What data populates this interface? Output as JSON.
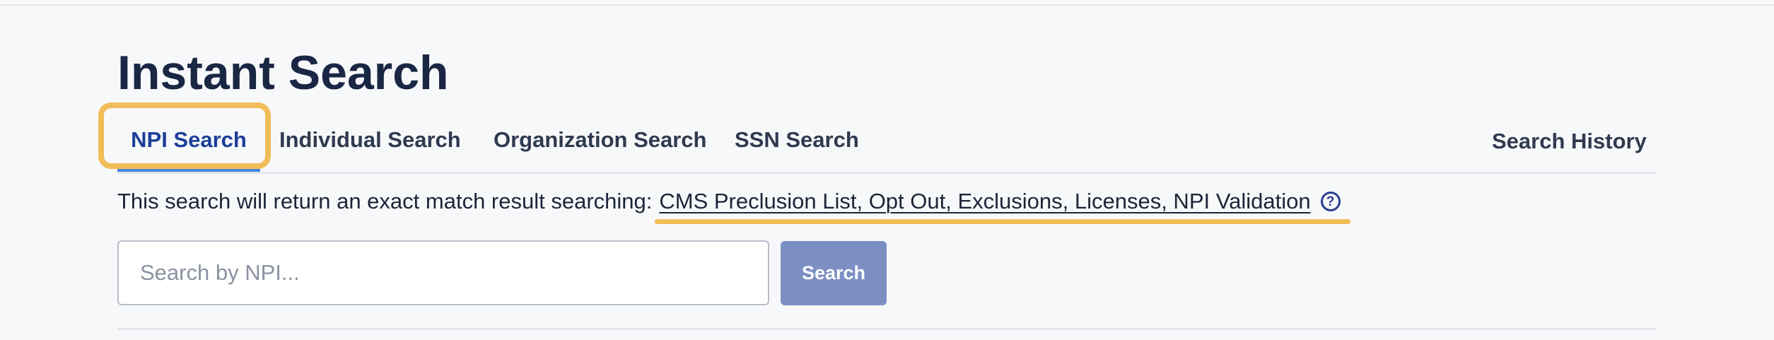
{
  "page": {
    "title": "Instant Search"
  },
  "tabs": [
    {
      "label": "NPI Search",
      "active": true
    },
    {
      "label": "Individual Search",
      "active": false
    },
    {
      "label": "Organization Search",
      "active": false
    },
    {
      "label": "SSN Search",
      "active": false
    }
  ],
  "history": {
    "label": "Search History"
  },
  "sources": {
    "prefix": "This search will return an exact match result searching:",
    "list": "CMS Preclusion List, Opt Out, Exclusions, Licenses, NPI Validation",
    "help_icon_glyph": "?",
    "help_icon_name": "question-circle-icon"
  },
  "search": {
    "placeholder": "Search by NPI...",
    "value": "",
    "button_label": "Search"
  },
  "colors": {
    "background": "#f7f8fa",
    "title": "#1a2744",
    "active_tab": "#1d3f9a",
    "active_underline": "#4a85e0",
    "highlight": "#f1bd58",
    "button": "#7b8fc3"
  }
}
